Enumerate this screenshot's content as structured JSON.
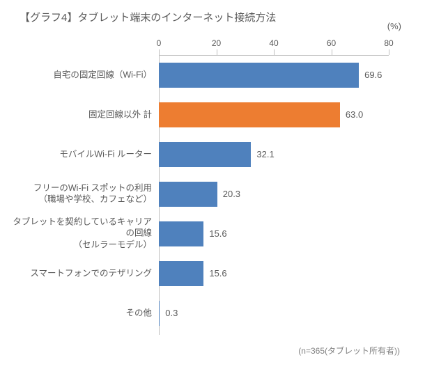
{
  "title": "【グラフ4】タブレット端末のインターネット接続方法",
  "unit_label": "(%)",
  "footnote": "(n=365(タブレット所有者))",
  "axis": {
    "ticks": [
      0,
      20,
      40,
      60,
      80
    ],
    "max": 80
  },
  "colors": {
    "primary": "#4f81bd",
    "accent": "#ed7d31"
  },
  "chart_data": {
    "type": "bar",
    "orientation": "horizontal",
    "title": "【グラフ4】タブレット端末のインターネット接続方法",
    "xlabel": "(%)",
    "ylabel": "",
    "xlim": [
      0,
      80
    ],
    "categories": [
      "自宅の固定回線（Wi-Fi）",
      "固定回線以外 計",
      "モバイルWi-Fi ルーター",
      "フリーのWi-Fi スポットの利用\n（職場や学校、カフェなど）",
      "タブレットを契約しているキャリアの回線\n（セルラーモデル）",
      "スマートフォンでのテザリング",
      "その他"
    ],
    "values": [
      69.6,
      63.0,
      32.1,
      20.3,
      15.6,
      15.6,
      0.3
    ],
    "highlight_index": 1,
    "n": 365,
    "n_label": "タブレット所有者"
  }
}
